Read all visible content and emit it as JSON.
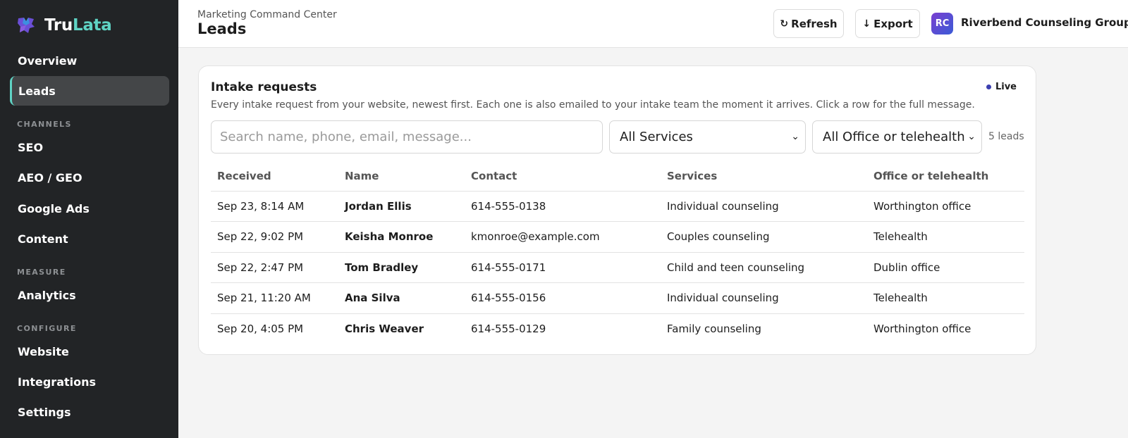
{
  "brand": {
    "part1": "Tru",
    "part2": "Lata"
  },
  "sidebar": {
    "items": [
      {
        "label": "Overview",
        "active": false
      },
      {
        "label": "Leads",
        "active": true
      }
    ],
    "channels_label": "CHANNELS",
    "channels": [
      {
        "label": "SEO"
      },
      {
        "label": "AEO / GEO"
      },
      {
        "label": "Google Ads"
      },
      {
        "label": "Content"
      }
    ],
    "measure_label": "MEASURE",
    "measure": [
      {
        "label": "Analytics"
      }
    ],
    "configure_label": "CONFIGURE",
    "configure": [
      {
        "label": "Website"
      },
      {
        "label": "Integrations"
      },
      {
        "label": "Settings"
      }
    ]
  },
  "header": {
    "breadcrumb": "Marketing Command Center",
    "title": "Leads",
    "refresh_label": "Refresh",
    "export_label": "Export",
    "avatar_initials": "RC",
    "org_name": "Riverbend Counseling Group"
  },
  "card": {
    "title": "Intake requests",
    "live_label": "Live",
    "description": "Every intake request from your website, newest first. Each one is also emailed to your intake team the moment it arrives. Click a row for the full message.",
    "search_placeholder": "Search name, phone, email, message...",
    "services_filter": "All Services",
    "office_filter": "All Office or telehealth",
    "count": "5 leads"
  },
  "table": {
    "headers": [
      "Received",
      "Name",
      "Contact",
      "Services",
      "Office or telehealth"
    ],
    "rows": [
      {
        "received": "Sep 23, 8:14 AM",
        "name": "Jordan Ellis",
        "contact": "614-555-0138",
        "service": "Individual counseling",
        "office": "Worthington office"
      },
      {
        "received": "Sep 22, 9:02 PM",
        "name": "Keisha Monroe",
        "contact": "kmonroe@example.com",
        "service": "Couples counseling",
        "office": "Telehealth"
      },
      {
        "received": "Sep 22, 2:47 PM",
        "name": "Tom Bradley",
        "contact": "614-555-0171",
        "service": "Child and teen counseling",
        "office": "Dublin office"
      },
      {
        "received": "Sep 21, 11:20 AM",
        "name": "Ana Silva",
        "contact": "614-555-0156",
        "service": "Individual counseling",
        "office": "Telehealth"
      },
      {
        "received": "Sep 20, 4:05 PM",
        "name": "Chris Weaver",
        "contact": "614-555-0129",
        "service": "Family counseling",
        "office": "Worthington office"
      }
    ]
  },
  "colors": {
    "sidebar_bg": "#222426",
    "accent": "#5fd3c4",
    "live_dot": "#3b3fb0"
  }
}
